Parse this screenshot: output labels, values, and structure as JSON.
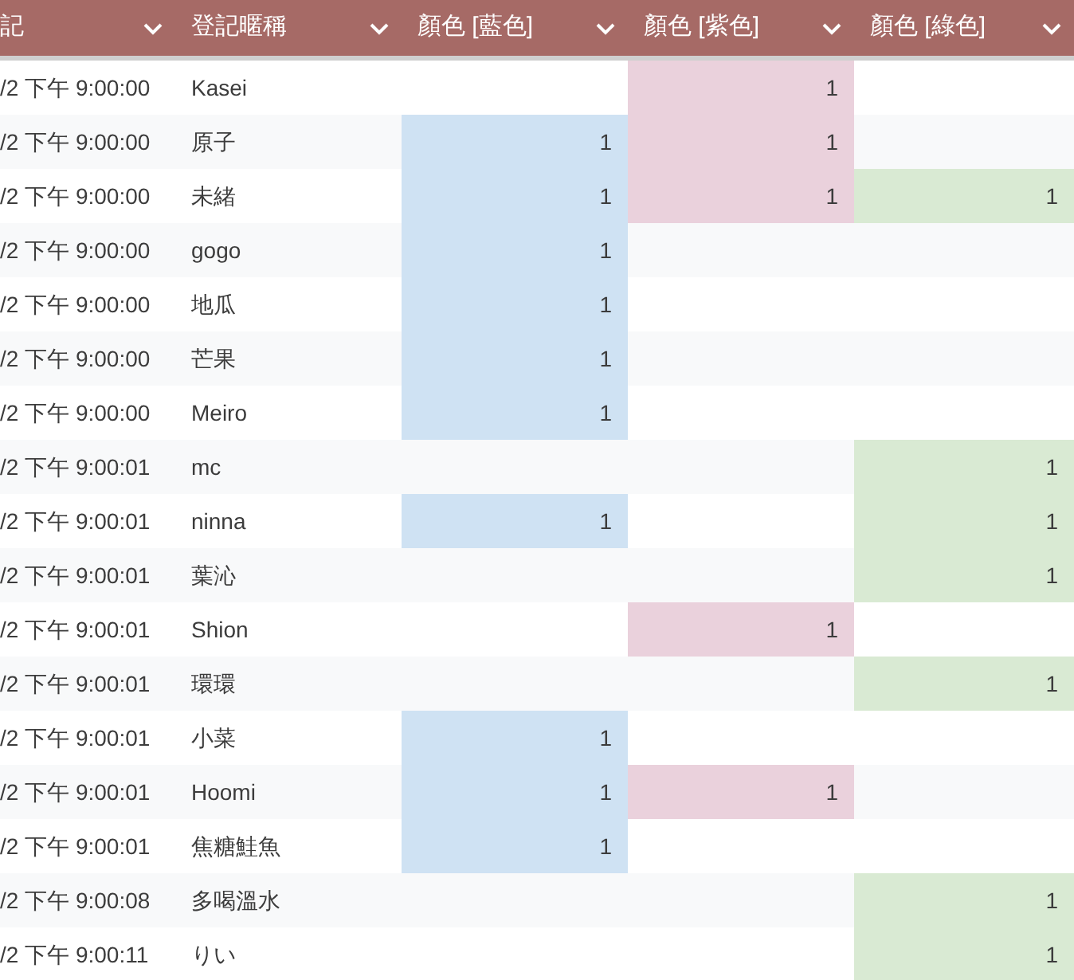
{
  "columns": [
    {
      "label": "記"
    },
    {
      "label": "登記暱稱"
    },
    {
      "label": "顏色 [藍色]",
      "color": "#cfe2f3"
    },
    {
      "label": "顏色 [紫色]",
      "color": "#ead1dc"
    },
    {
      "label": "顏色 [綠色]",
      "color": "#d9ead3"
    }
  ],
  "rows": [
    {
      "time": "/2 下午 9:00:00",
      "nickname": "Kasei",
      "column_4": "1"
    },
    {
      "time": "/2 下午 9:00:00",
      "nickname": "原子",
      "column_3": "1",
      "column_4": "1"
    },
    {
      "time": "/2 下午 9:00:00",
      "nickname": "未緒",
      "column_3": "1",
      "column_4": "1",
      "column_5": "1"
    },
    {
      "time": "/2 下午 9:00:00",
      "nickname": "gogo",
      "column_3": "1"
    },
    {
      "time": "/2 下午 9:00:00",
      "nickname": "地瓜",
      "column_3": "1"
    },
    {
      "time": "/2 下午 9:00:00",
      "nickname": "芒果",
      "column_3": "1"
    },
    {
      "time": "/2 下午 9:00:00",
      "nickname": "Meiro",
      "column_3": "1"
    },
    {
      "time": "/2 下午 9:00:01",
      "nickname": "mc",
      "column_5": "1"
    },
    {
      "time": "/2 下午 9:00:01",
      "nickname": "ninna",
      "column_3": "1",
      "column_5": "1"
    },
    {
      "time": "/2 下午 9:00:01",
      "nickname": "葉沁",
      "column_5": "1"
    },
    {
      "time": "/2 下午 9:00:01",
      "nickname": "Shion",
      "column_4": "1"
    },
    {
      "time": "/2 下午 9:00:01",
      "nickname": "環環",
      "column_5": "1"
    },
    {
      "time": "/2 下午 9:00:01",
      "nickname": "小菜",
      "column_3": "1"
    },
    {
      "time": "/2 下午 9:00:01",
      "nickname": "Hoomi",
      "column_3": "1",
      "column_4": "1"
    },
    {
      "time": "/2 下午 9:00:01",
      "nickname": "焦糖鮭魚",
      "column_3": "1"
    },
    {
      "time": "/2 下午 9:00:08",
      "nickname": "多喝溫水",
      "column_5": "1"
    },
    {
      "time": "/2 下午 9:00:11",
      "nickname": "りい",
      "column_5": "1"
    }
  ]
}
